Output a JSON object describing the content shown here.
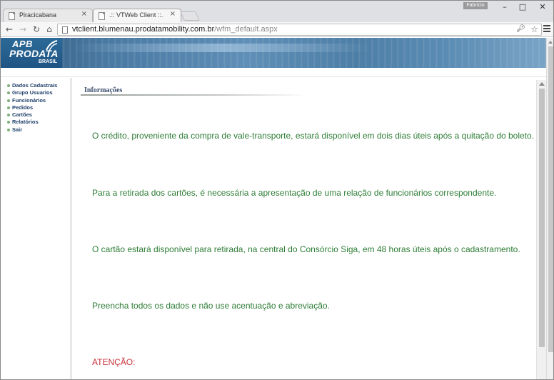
{
  "browser": {
    "tabs": [
      {
        "title": "Piracicabana",
        "close": "×",
        "active": false
      },
      {
        "title": ".:: VTWeb Client ::.",
        "close": "×",
        "active": true
      }
    ],
    "profile": "Fabrício",
    "window_controls": {
      "minimize": "–",
      "maximize": "□",
      "close": "✕"
    },
    "nav": {
      "back": "←",
      "forward": "→",
      "reload": "↻",
      "home": "⌂"
    },
    "address": {
      "host": "vtclient.blumenau.prodatamobility.com.br",
      "path": "/wfm_default.aspx"
    },
    "icons": {
      "key": "key-icon",
      "star": "star-icon",
      "menu": "menu-icon"
    }
  },
  "logo": {
    "line1": "APB",
    "line2": "PRODATA",
    "line3": "BRASIL"
  },
  "sidebar": {
    "items": [
      {
        "label": "Dados Cadastrais"
      },
      {
        "label": "Grupo Usuarios"
      },
      {
        "label": "Funcionários"
      },
      {
        "label": "Pedidos"
      },
      {
        "label": "Cartões"
      },
      {
        "label": "Relatórios"
      },
      {
        "label": "Sair"
      }
    ]
  },
  "content": {
    "section_title": "Informações",
    "messages": [
      "O crédito, proveniente da compra de vale-transporte, estará disponível em dois dias úteis após a quitação do boleto.",
      "Para a retirada dos cartões, é necessária a apresentação de uma relação de funcionários correspondente.",
      "O cartão estará disponível para retirada, na central do Consórcio Siga, em 48 horas úteis após o cadastramento.",
      "Preencha todos os dados e não use acentuação e abreviação."
    ],
    "attention": "ATENÇÃO:"
  },
  "colors": {
    "brand_blue": "#2c6a98",
    "message_green": "#2d7d35",
    "attention_red": "#c8313a",
    "menu_navy": "#1f3f6a"
  }
}
